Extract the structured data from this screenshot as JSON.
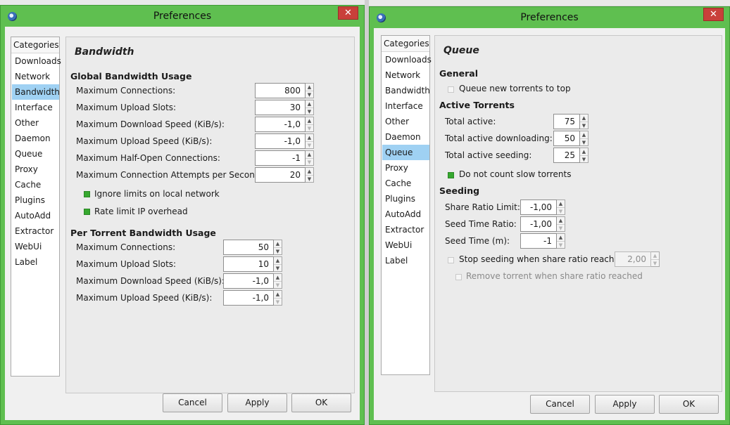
{
  "left": {
    "title": "Preferences",
    "close": "✕",
    "categories_header": "Categories",
    "categories": [
      "Downloads",
      "Network",
      "Bandwidth",
      "Interface",
      "Other",
      "Daemon",
      "Queue",
      "Proxy",
      "Cache",
      "Plugins",
      "AutoAdd",
      "Extractor",
      "WebUi",
      "Label"
    ],
    "selected_category": "Bandwidth",
    "page_title": "Bandwidth",
    "global_header": "Global Bandwidth Usage",
    "global_max_connections_label": "Maximum Connections:",
    "global_max_connections": "800",
    "global_max_upload_slots_label": "Maximum Upload Slots:",
    "global_max_upload_slots": "30",
    "global_max_download_speed_label": "Maximum Download Speed (KiB/s):",
    "global_max_download_speed": "-1,0",
    "global_max_upload_speed_label": "Maximum Upload Speed (KiB/s):",
    "global_max_upload_speed": "-1,0",
    "global_max_half_open_label": "Maximum Half-Open Connections:",
    "global_max_half_open": "-1",
    "global_max_conn_attempts_label": "Maximum Connection Attempts per Second:",
    "global_max_conn_attempts": "20",
    "ignore_limits_label": "Ignore limits on local network",
    "ignore_limits_checked": true,
    "rate_limit_ip_label": "Rate limit IP overhead",
    "rate_limit_ip_checked": true,
    "per_torrent_header": "Per Torrent Bandwidth Usage",
    "pt_max_connections_label": "Maximum Connections:",
    "pt_max_connections": "50",
    "pt_max_upload_slots_label": "Maximum Upload Slots:",
    "pt_max_upload_slots": "10",
    "pt_max_download_speed_label": "Maximum Download Speed (KiB/s):",
    "pt_max_download_speed": "-1,0",
    "pt_max_upload_speed_label": "Maximum Upload Speed (KiB/s):",
    "pt_max_upload_speed": "-1,0",
    "cancel": "Cancel",
    "apply": "Apply",
    "ok": "OK"
  },
  "right": {
    "title": "Preferences",
    "close": "✕",
    "categories_header": "Categories",
    "categories": [
      "Downloads",
      "Network",
      "Bandwidth",
      "Interface",
      "Other",
      "Daemon",
      "Queue",
      "Proxy",
      "Cache",
      "Plugins",
      "AutoAdd",
      "Extractor",
      "WebUi",
      "Label"
    ],
    "selected_category": "Queue",
    "page_title": "Queue",
    "general_header": "General",
    "queue_new_top_label": "Queue new torrents to top",
    "queue_new_top_checked": false,
    "active_header": "Active Torrents",
    "total_active_label": "Total active:",
    "total_active": "75",
    "total_active_downloading_label": "Total active downloading:",
    "total_active_downloading": "50",
    "total_active_seeding_label": "Total active seeding:",
    "total_active_seeding": "25",
    "dont_count_slow_label": "Do not count slow torrents",
    "dont_count_slow_checked": true,
    "seeding_header": "Seeding",
    "share_ratio_limit_label": "Share Ratio Limit:",
    "share_ratio_limit": "-1,00",
    "seed_time_ratio_label": "Seed Time Ratio:",
    "seed_time_ratio": "-1,00",
    "seed_time_label": "Seed Time (m):",
    "seed_time": "-1",
    "stop_seeding_label": "Stop seeding when share ratio reaches:",
    "stop_seeding_checked": false,
    "stop_seeding_value": "2,00",
    "remove_torrent_label": "Remove torrent when share ratio reached",
    "remove_torrent_checked": false,
    "cancel": "Cancel",
    "apply": "Apply",
    "ok": "OK"
  }
}
